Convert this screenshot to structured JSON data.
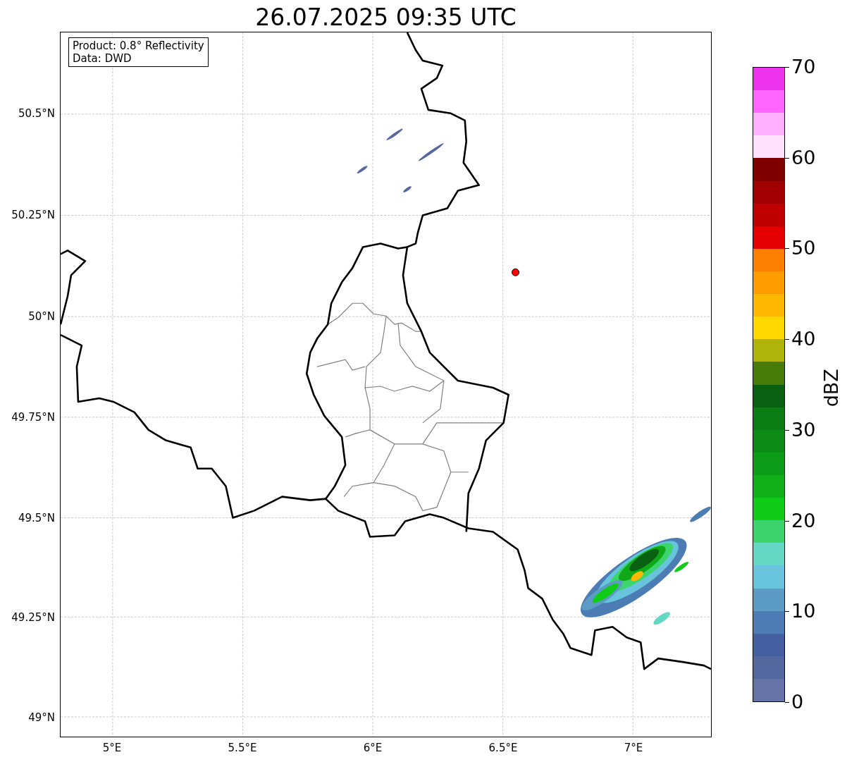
{
  "title": "26.07.2025 09:35 UTC",
  "info_box": {
    "lines": [
      "Product: 0.8° Reflectivity",
      "Data: DWD"
    ]
  },
  "map": {
    "lat_ticks": [
      "50.5°N",
      "50.25°N",
      "50°N",
      "49.75°N",
      "49.5°N",
      "49.25°N",
      "49°N"
    ],
    "lon_ticks": [
      "5°E",
      "5.5°E",
      "6°E",
      "6.5°E",
      "7°E"
    ]
  },
  "colorbar": {
    "label": "dBZ",
    "ticks": [
      "70",
      "60",
      "50",
      "40",
      "30",
      "20",
      "10",
      "0"
    ],
    "bins": [
      {
        "color": "#ee33ee"
      },
      {
        "color": "#ff66ff"
      },
      {
        "color": "#ffb0ff"
      },
      {
        "color": "#ffe0ff"
      },
      {
        "color": "#800000"
      },
      {
        "color": "#a00000"
      },
      {
        "color": "#c00000"
      },
      {
        "color": "#e40000"
      },
      {
        "color": "#ff8000"
      },
      {
        "color": "#ff9c00"
      },
      {
        "color": "#ffb800"
      },
      {
        "color": "#ffd800"
      },
      {
        "color": "#b0b408"
      },
      {
        "color": "#487c08"
      },
      {
        "color": "#086010"
      },
      {
        "color": "#0c7c14"
      },
      {
        "color": "#0c8c14"
      },
      {
        "color": "#0c9c18"
      },
      {
        "color": "#10b018"
      },
      {
        "color": "#10cc18"
      },
      {
        "color": "#3cd46c"
      },
      {
        "color": "#64d8c4"
      },
      {
        "color": "#68c4dc"
      },
      {
        "color": "#5c9cc4"
      },
      {
        "color": "#4c7cb4"
      },
      {
        "color": "#4460a0"
      },
      {
        "color": "#5468a0"
      },
      {
        "color": "#6474a8"
      }
    ]
  }
}
